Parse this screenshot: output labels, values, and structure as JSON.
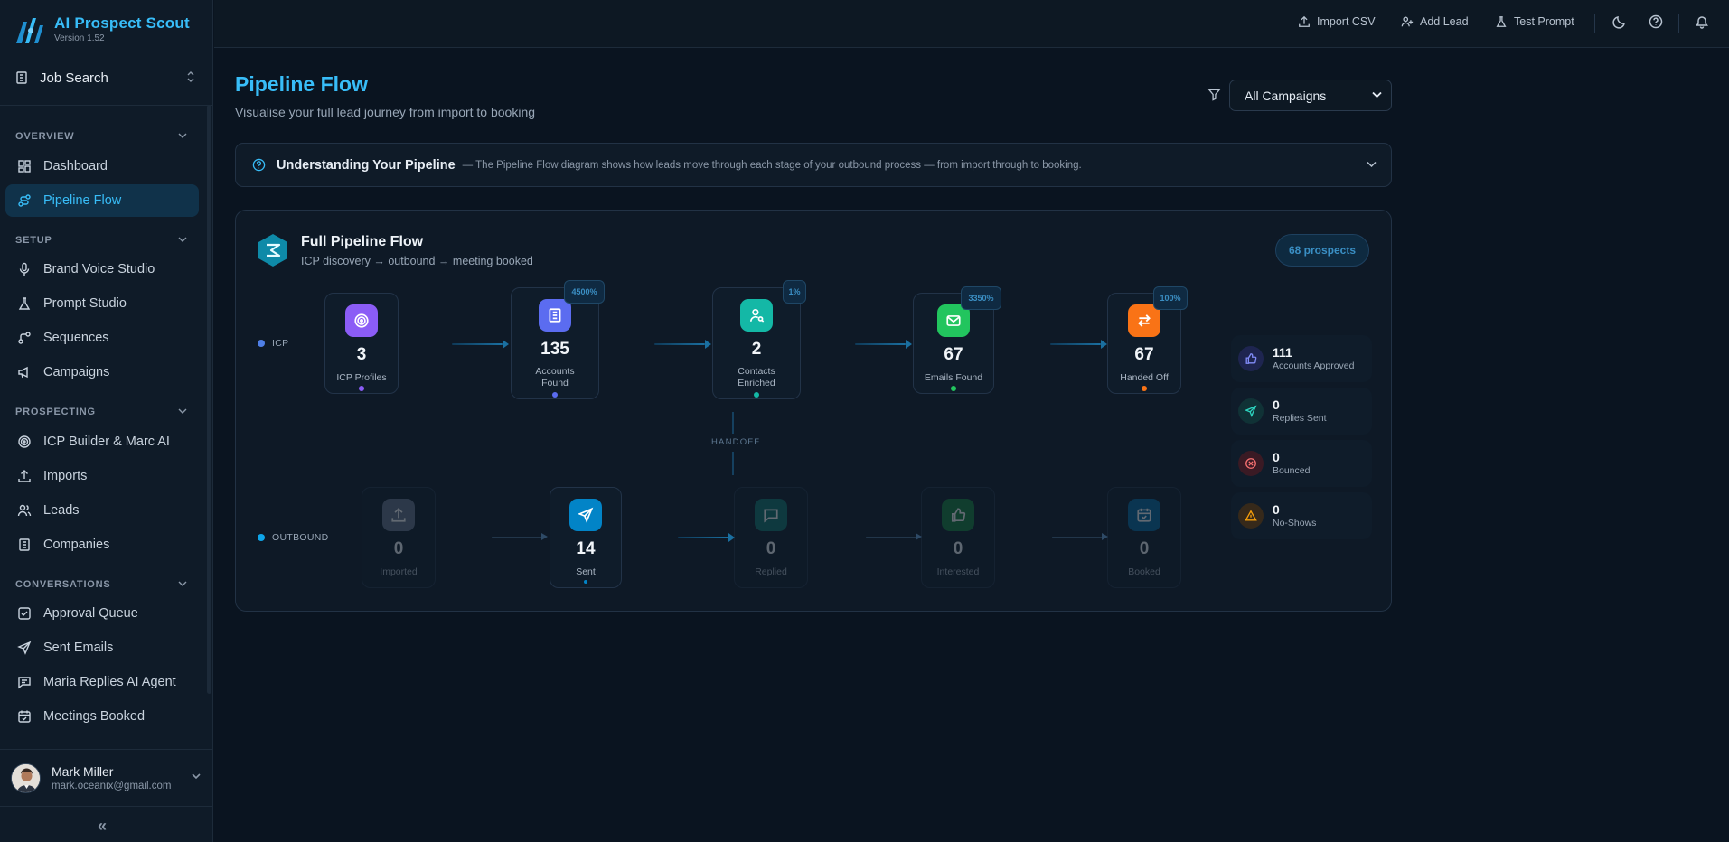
{
  "app": {
    "name": "AI Prospect Scout",
    "version": "Version 1.52"
  },
  "workspace": {
    "label": "Job Search"
  },
  "sidebar": {
    "sections": [
      {
        "label": "OVERVIEW",
        "items": [
          "Dashboard",
          "Pipeline Flow"
        ]
      },
      {
        "label": "SETUP",
        "items": [
          "Brand Voice Studio",
          "Prompt Studio",
          "Sequences",
          "Campaigns"
        ]
      },
      {
        "label": "PROSPECTING",
        "items": [
          "ICP Builder & Marc AI",
          "Imports",
          "Leads",
          "Companies"
        ]
      },
      {
        "label": "CONVERSATIONS",
        "items": [
          "Approval Queue",
          "Sent Emails",
          "Maria Replies AI Agent",
          "Meetings Booked"
        ]
      }
    ],
    "active_item": "Pipeline Flow",
    "collapse_glyph": "«"
  },
  "user": {
    "name": "Mark Miller",
    "email": "mark.oceanix@gmail.com"
  },
  "topbar": {
    "import_csv": "Import CSV",
    "add_lead": "Add Lead",
    "test_prompt": "Test Prompt"
  },
  "page": {
    "title": "Pipeline Flow",
    "subtitle": "Visualise your full lead journey from import to booking"
  },
  "campaign_filter": {
    "selected": "All Campaigns"
  },
  "info_banner": {
    "title": "Understanding Your Pipeline",
    "text": "— The Pipeline Flow diagram shows how leads move through each stage of your outbound process — from import through to booking."
  },
  "flow": {
    "title": "Full Pipeline Flow",
    "subtitle": "ICP discovery → outbound → meeting booked",
    "prospects": "68 prospects",
    "handoff_label": "HANDOFF",
    "icp_row": {
      "label": "ICP",
      "nodes": [
        {
          "value": "3",
          "label": "ICP Profiles",
          "badge": "",
          "icon": "target-icon",
          "color": "#8b5cf6"
        },
        {
          "value": "135",
          "label": "Accounts Found",
          "badge": "4500%",
          "icon": "building-icon",
          "color": "#5b6cf0"
        },
        {
          "value": "2",
          "label": "Contacts Enriched",
          "badge": "1%",
          "icon": "user-search-icon",
          "color": "#14b8a6"
        },
        {
          "value": "67",
          "label": "Emails Found",
          "badge": "3350%",
          "icon": "mail-icon",
          "color": "#22c55e"
        },
        {
          "value": "67",
          "label": "Handed Off",
          "badge": "100%",
          "icon": "swap-icon",
          "color": "#f97316"
        }
      ]
    },
    "outbound_row": {
      "label": "OUTBOUND",
      "nodes": [
        {
          "value": "0",
          "label": "Imported",
          "icon": "upload-icon",
          "color": "#64748b",
          "active": false
        },
        {
          "value": "14",
          "label": "Sent",
          "icon": "send-icon",
          "color": "#0ea5e9",
          "active": true
        },
        {
          "value": "0",
          "label": "Replied",
          "icon": "message-icon",
          "color": "#0d9488",
          "active": false
        },
        {
          "value": "0",
          "label": "Interested",
          "icon": "thumbs-up-icon",
          "color": "#16a34a",
          "active": false
        },
        {
          "value": "0",
          "label": "Booked",
          "icon": "calendar-icon",
          "color": "#0369a1",
          "active": false
        }
      ]
    },
    "stats": [
      {
        "value": "111",
        "label": "Accounts Approved",
        "icon": "thumbs-up-icon",
        "color": "#6366f1"
      },
      {
        "value": "0",
        "label": "Replies Sent",
        "icon": "send-icon",
        "color": "#14b8a6"
      },
      {
        "value": "0",
        "label": "Bounced",
        "icon": "x-circle-icon",
        "color": "#ef4444"
      },
      {
        "value": "0",
        "label": "No-Shows",
        "icon": "alert-icon",
        "color": "#f59e0b"
      }
    ]
  }
}
